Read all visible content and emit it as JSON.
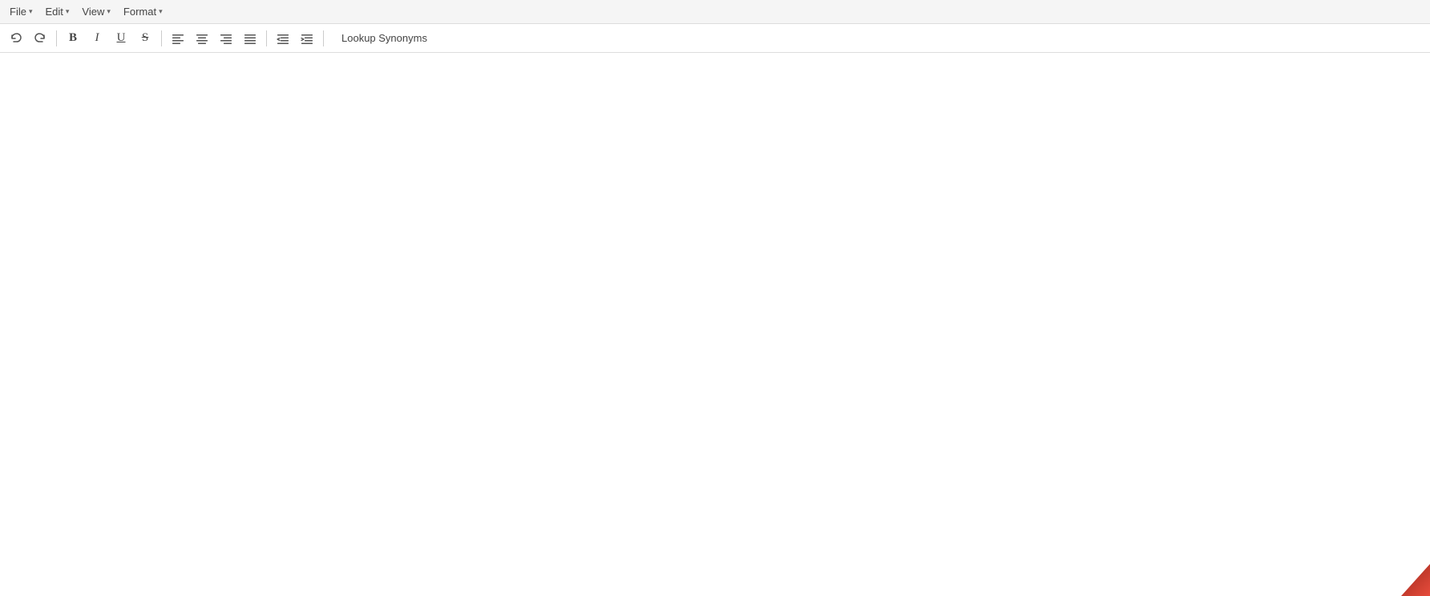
{
  "menubar": {
    "file": {
      "label": "File",
      "has_chevron": true
    },
    "edit": {
      "label": "Edit",
      "has_chevron": true
    },
    "view": {
      "label": "View",
      "has_chevron": true
    },
    "format": {
      "label": "Format",
      "has_chevron": true
    }
  },
  "toolbar": {
    "undo_label": "↩",
    "redo_label": "↪",
    "bold_label": "B",
    "italic_label": "I",
    "underline_label": "U",
    "strikethrough_label": "S",
    "align_left_label": "align-left",
    "align_center_label": "align-center",
    "align_right_label": "align-right",
    "align_justify_label": "align-justify",
    "indent_decrease_label": "indent-decrease",
    "indent_increase_label": "indent-increase",
    "synonyms_label": "Lookup Synonyms"
  },
  "editor": {
    "content": ""
  }
}
